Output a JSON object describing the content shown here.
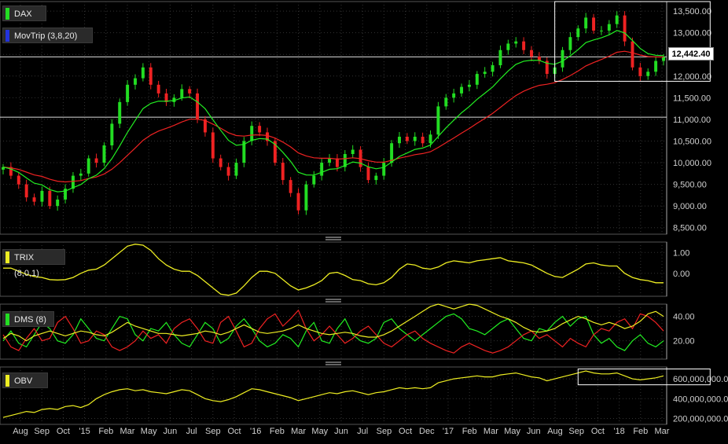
{
  "colors": {
    "background": "#000000",
    "grid": "#333333",
    "axis_text": "#d0d0d0",
    "up_candle": "#22dd22",
    "down_candle": "#ee2222",
    "trix": "#eeee22",
    "movtrip_fast": "#22ee22",
    "movtrip_slow": "#ee2222",
    "dms_plus": "#22ee22",
    "dms_minus": "#ee2222",
    "dms_adx": "#eeee22",
    "obv": "#eeee22",
    "dax_swatch": "#22dd22",
    "movtrip_swatch": "#2233dd",
    "trix_swatch": "#eeee22",
    "dms_swatch": "#22dd22",
    "obv_swatch": "#eeee22",
    "divider": "#c8c8c8"
  },
  "legends": {
    "dax": "DAX",
    "movtrip": "MovTrip (3,8,20)",
    "trix": "TRIX (8,0,1)",
    "dms": "DMS (8)",
    "obv": "OBV"
  },
  "last_price_label": "12,442.40",
  "chart_data": [
    {
      "type": "candlestick",
      "name": "DAX",
      "x_labels": [
        "Aug",
        "Sep",
        "Oct",
        "'15",
        "Feb",
        "Mar",
        "May",
        "Jun",
        "Jul",
        "Sep",
        "Oct",
        "'16",
        "Feb",
        "Mar",
        "May",
        "Jun",
        "Jul",
        "Sep",
        "Oct",
        "Dec",
        "'17",
        "Feb",
        "Mar",
        "May",
        "Jun",
        "Aug",
        "Sep",
        "Oct",
        "'18",
        "Feb",
        "Mar"
      ],
      "y_ticks": [
        "8,500.00",
        "9,000.00",
        "9,500.00",
        "10,000.00",
        "10,500.00",
        "11,000.00",
        "11,500.00",
        "12,000.00",
        "12,500.00",
        "13,000.00",
        "13,500.00"
      ],
      "ylim": [
        8350,
        13720
      ],
      "closes": [
        9900,
        9700,
        9500,
        9200,
        9100,
        9350,
        9000,
        9150,
        9400,
        9700,
        9750,
        10100,
        10000,
        10400,
        10900,
        11400,
        11800,
        11950,
        12200,
        11800,
        11600,
        11400,
        11500,
        11700,
        11600,
        11000,
        10700,
        10100,
        9900,
        9700,
        10000,
        10500,
        10850,
        10700,
        10500,
        10000,
        9600,
        9300,
        8900,
        9500,
        9700,
        10000,
        10100,
        9900,
        10200,
        10300,
        9900,
        9600,
        9700,
        10000,
        10450,
        10600,
        10500,
        10600,
        10450,
        10650,
        11300,
        11500,
        11600,
        11750,
        11800,
        12050,
        12100,
        12250,
        12600,
        12750,
        12800,
        12600,
        12450,
        12350,
        12050,
        12200,
        12600,
        12900,
        13100,
        13350,
        13050,
        13050,
        13200,
        13400,
        12800,
        12200,
        12000,
        12100,
        12350,
        12442.4
      ],
      "volatility": 110,
      "movtrip_fast_period": 8,
      "movtrip_slow_period": 20,
      "highlight_box": {
        "x_start_index": 71,
        "x_end_index": 91,
        "y_range": [
          11880,
          13720
        ]
      },
      "reference_lines": [
        12442.4,
        11050
      ]
    },
    {
      "type": "line",
      "name": "TRIX (8,0,1)",
      "y_ticks": [
        "1.00",
        "0.00"
      ],
      "ylim": [
        -1.1,
        1.5
      ],
      "values": [
        0.25,
        0.25,
        0.1,
        -0.05,
        -0.15,
        -0.2,
        -0.3,
        -0.32,
        -0.3,
        -0.2,
        0.0,
        0.15,
        0.2,
        0.4,
        0.7,
        1.0,
        1.3,
        1.4,
        1.35,
        1.1,
        0.7,
        0.4,
        0.2,
        0.1,
        0.1,
        -0.1,
        -0.4,
        -0.7,
        -1.0,
        -1.05,
        -0.95,
        -0.6,
        -0.2,
        0.1,
        0.1,
        0.0,
        -0.3,
        -0.6,
        -0.8,
        -0.7,
        -0.55,
        -0.35,
        0.0,
        0.05,
        -0.1,
        -0.3,
        -0.35,
        -0.5,
        -0.55,
        -0.45,
        -0.2,
        0.2,
        0.45,
        0.4,
        0.25,
        0.2,
        0.3,
        0.5,
        0.6,
        0.55,
        0.5,
        0.6,
        0.65,
        0.7,
        0.75,
        0.6,
        0.55,
        0.5,
        0.4,
        0.2,
        0.0,
        -0.15,
        -0.2,
        0.0,
        0.2,
        0.45,
        0.5,
        0.4,
        0.35,
        0.35,
        0.0,
        -0.2,
        -0.3,
        -0.35,
        -0.45,
        -0.45
      ]
    },
    {
      "type": "line",
      "name": "DMS (8)",
      "y_ticks": [
        "40.00",
        "20.00"
      ],
      "ylim": [
        5,
        50
      ],
      "series": [
        {
          "values": [
            20,
            28,
            18,
            15,
            25,
            35,
            30,
            20,
            18,
            25,
            38,
            30,
            22,
            20,
            30,
            40,
            38,
            25,
            20,
            30,
            28,
            35,
            25,
            18,
            15,
            25,
            35,
            30,
            18,
            22,
            32,
            38,
            30,
            20,
            15,
            18,
            25,
            22,
            15,
            28,
            35,
            20,
            18,
            30,
            38,
            25,
            20,
            18,
            22,
            35,
            38,
            30,
            25,
            20,
            25,
            30,
            35,
            40,
            42,
            38,
            30,
            28,
            25,
            30,
            35,
            38,
            30,
            22,
            20,
            30,
            28,
            35,
            40,
            32,
            38,
            40,
            25,
            18,
            22,
            15,
            12,
            20,
            25,
            18,
            15,
            20
          ]
        },
        {
          "values": [
            25,
            15,
            12,
            22,
            30,
            20,
            22,
            35,
            40,
            30,
            18,
            20,
            28,
            25,
            15,
            12,
            15,
            20,
            28,
            22,
            25,
            18,
            30,
            35,
            38,
            30,
            20,
            18,
            35,
            40,
            28,
            15,
            18,
            30,
            38,
            42,
            32,
            38,
            45,
            30,
            20,
            25,
            32,
            25,
            18,
            22,
            28,
            32,
            25,
            18,
            15,
            20,
            25,
            28,
            22,
            18,
            15,
            12,
            10,
            15,
            18,
            15,
            12,
            10,
            12,
            15,
            20,
            25,
            28,
            22,
            25,
            20,
            15,
            22,
            18,
            15,
            25,
            30,
            28,
            35,
            38,
            30,
            42,
            40,
            35,
            28
          ]
        },
        {
          "values": [
            22,
            26,
            24,
            20,
            24,
            26,
            28,
            26,
            24,
            26,
            28,
            27,
            25,
            24,
            27,
            31,
            35,
            32,
            30,
            28,
            26,
            26,
            25,
            24,
            25,
            26,
            28,
            27,
            25,
            27,
            30,
            33,
            30,
            27,
            26,
            27,
            28,
            30,
            33,
            30,
            28,
            26,
            25,
            26,
            27,
            26,
            24,
            23,
            23,
            25,
            28,
            32,
            36,
            40,
            44,
            48,
            50,
            48,
            46,
            48,
            50,
            49,
            46,
            43,
            40,
            38,
            35,
            31,
            28,
            27,
            28,
            30,
            34,
            37,
            40,
            38,
            35,
            33,
            35,
            33,
            30,
            32,
            36,
            42,
            44,
            40
          ]
        }
      ]
    },
    {
      "type": "line",
      "name": "OBV",
      "y_ticks": [
        "600,000,000.0",
        "400,000,000.0",
        "200,000,000.0"
      ],
      "ylim": [
        140000000,
        720000000
      ],
      "values": [
        210000000,
        230000000,
        250000000,
        270000000,
        260000000,
        290000000,
        300000000,
        290000000,
        320000000,
        330000000,
        310000000,
        340000000,
        400000000,
        440000000,
        470000000,
        490000000,
        500000000,
        480000000,
        490000000,
        470000000,
        460000000,
        450000000,
        470000000,
        490000000,
        480000000,
        440000000,
        400000000,
        380000000,
        370000000,
        390000000,
        420000000,
        460000000,
        500000000,
        490000000,
        470000000,
        450000000,
        430000000,
        410000000,
        380000000,
        400000000,
        420000000,
        440000000,
        460000000,
        450000000,
        470000000,
        480000000,
        460000000,
        440000000,
        460000000,
        470000000,
        490000000,
        510000000,
        500000000,
        510000000,
        500000000,
        510000000,
        560000000,
        580000000,
        600000000,
        610000000,
        620000000,
        630000000,
        620000000,
        620000000,
        640000000,
        650000000,
        660000000,
        640000000,
        620000000,
        610000000,
        580000000,
        600000000,
        620000000,
        640000000,
        660000000,
        680000000,
        660000000,
        650000000,
        650000000,
        660000000,
        630000000,
        600000000,
        590000000,
        600000000,
        610000000,
        630000000
      ],
      "highlight_box": {
        "x_start_index": 74,
        "x_end_index": 91,
        "y_range": [
          540000000,
          700000000
        ]
      }
    }
  ]
}
